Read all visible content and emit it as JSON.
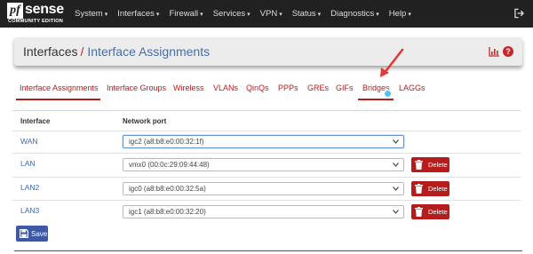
{
  "logo": {
    "mark": "pf",
    "name": "sense",
    "edition": "COMMUNITY EDITION"
  },
  "nav": {
    "items": [
      "System",
      "Interfaces",
      "Firewall",
      "Services",
      "VPN",
      "Status",
      "Diagnostics",
      "Help"
    ],
    "caret": "▾",
    "exit_icon": "sign-out-icon"
  },
  "breadcrumb": {
    "first": "Interfaces",
    "separator": "/",
    "current": "Interface Assignments"
  },
  "panel_icons": [
    "bar-chart-icon",
    "help-icon"
  ],
  "help_glyph": "?",
  "tabs": [
    {
      "label": "Interface Assignments",
      "active": true
    },
    {
      "label": "Interface Groups"
    },
    {
      "label": "Wireless"
    },
    {
      "label": "VLANs"
    },
    {
      "label": "QinQs"
    },
    {
      "label": "PPPs"
    },
    {
      "label": "GREs"
    },
    {
      "label": "GIFs"
    },
    {
      "label": "Bridges",
      "highlighted": true
    },
    {
      "label": "LAGGs"
    }
  ],
  "table": {
    "headers": [
      "Interface",
      "Network port"
    ],
    "rows": [
      {
        "interface": "WAN",
        "port": "igc2 (a8:b8:e0:00:32:1f)",
        "deletable": false
      },
      {
        "interface": "LAN",
        "port": "vmx0 (00:0c:29:09:44:48)",
        "deletable": true
      },
      {
        "interface": "LAN2",
        "port": "igc0 (a8:b8:e0:00:32:5a)",
        "deletable": true
      },
      {
        "interface": "LAN3",
        "port": "igc1 (a8:b8:e0:00:32:20)",
        "deletable": true
      }
    ],
    "delete_label": "Delete"
  },
  "save_label": "Save",
  "colors": {
    "navbar": "#212121",
    "accent_red": "#b71c1c",
    "link_blue": "#3c6ab3",
    "save_blue": "#3d59a6",
    "annotation": "#e53935"
  }
}
